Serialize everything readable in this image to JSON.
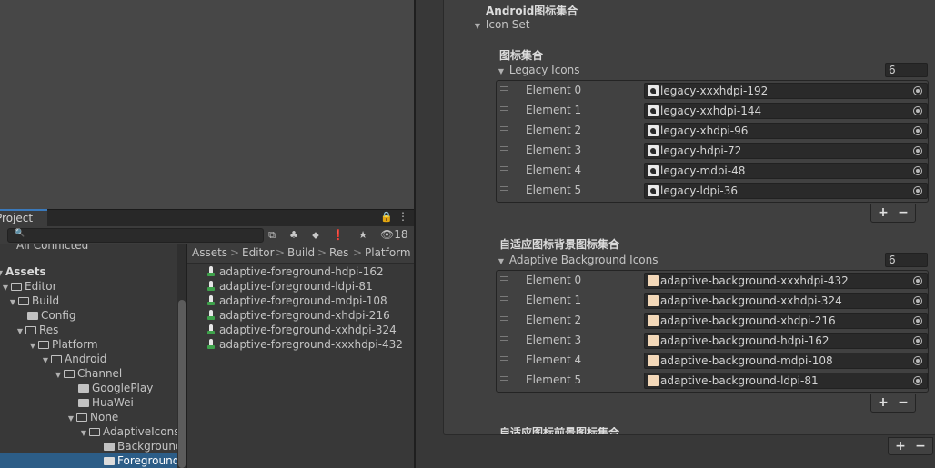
{
  "project": {
    "tab_label": "Project",
    "hidden_count": "18",
    "search_placeholder": "",
    "tree_top_cut": "All Conflicted",
    "tree": [
      {
        "label": "Assets",
        "bold": true
      },
      {
        "label": "Editor"
      },
      {
        "label": "Build"
      },
      {
        "label": "Config"
      },
      {
        "label": "Res"
      },
      {
        "label": "Platform"
      },
      {
        "label": "Android"
      },
      {
        "label": "Channel"
      },
      {
        "label": "GooglePlay"
      },
      {
        "label": "HuaWei"
      },
      {
        "label": "None"
      },
      {
        "label": "AdaptiveIcons"
      },
      {
        "label": "Background"
      },
      {
        "label": "Foreground"
      }
    ],
    "breadcrumb": [
      "Assets",
      "Editor",
      "Build",
      "Res",
      "Platform"
    ],
    "breadcrumb_sep": ">",
    "files": [
      "adaptive-foreground-hdpi-162",
      "adaptive-foreground-ldpi-81",
      "adaptive-foreground-mdpi-108",
      "adaptive-foreground-xhdpi-216",
      "adaptive-foreground-xxhdpi-324",
      "adaptive-foreground-xxxhdpi-432"
    ]
  },
  "inspector": {
    "section_title": "Android图标集合",
    "icon_set_label": "Icon Set",
    "legacy": {
      "header": "图标集合",
      "foldout": "Legacy Icons",
      "size": "6",
      "elements": [
        {
          "label": "Element 0",
          "value": "legacy-xxxhdpi-192"
        },
        {
          "label": "Element 1",
          "value": "legacy-xxhdpi-144"
        },
        {
          "label": "Element 2",
          "value": "legacy-xhdpi-96"
        },
        {
          "label": "Element 3",
          "value": "legacy-hdpi-72"
        },
        {
          "label": "Element 4",
          "value": "legacy-mdpi-48"
        },
        {
          "label": "Element 5",
          "value": "legacy-ldpi-36"
        }
      ]
    },
    "adaptive_bg": {
      "header": "自适应图标背景图标集合",
      "foldout": "Adaptive Background Icons",
      "size": "6",
      "elements": [
        {
          "label": "Element 0",
          "value": "adaptive-background-xxxhdpi-432"
        },
        {
          "label": "Element 1",
          "value": "adaptive-background-xxhdpi-324"
        },
        {
          "label": "Element 2",
          "value": "adaptive-background-xhdpi-216"
        },
        {
          "label": "Element 3",
          "value": "adaptive-background-hdpi-162"
        },
        {
          "label": "Element 4",
          "value": "adaptive-background-mdpi-108"
        },
        {
          "label": "Element 5",
          "value": "adaptive-background-ldpi-81"
        }
      ]
    },
    "next_header_cut": "自适应图标前景图标集合",
    "plus": "+",
    "minus": "−"
  }
}
